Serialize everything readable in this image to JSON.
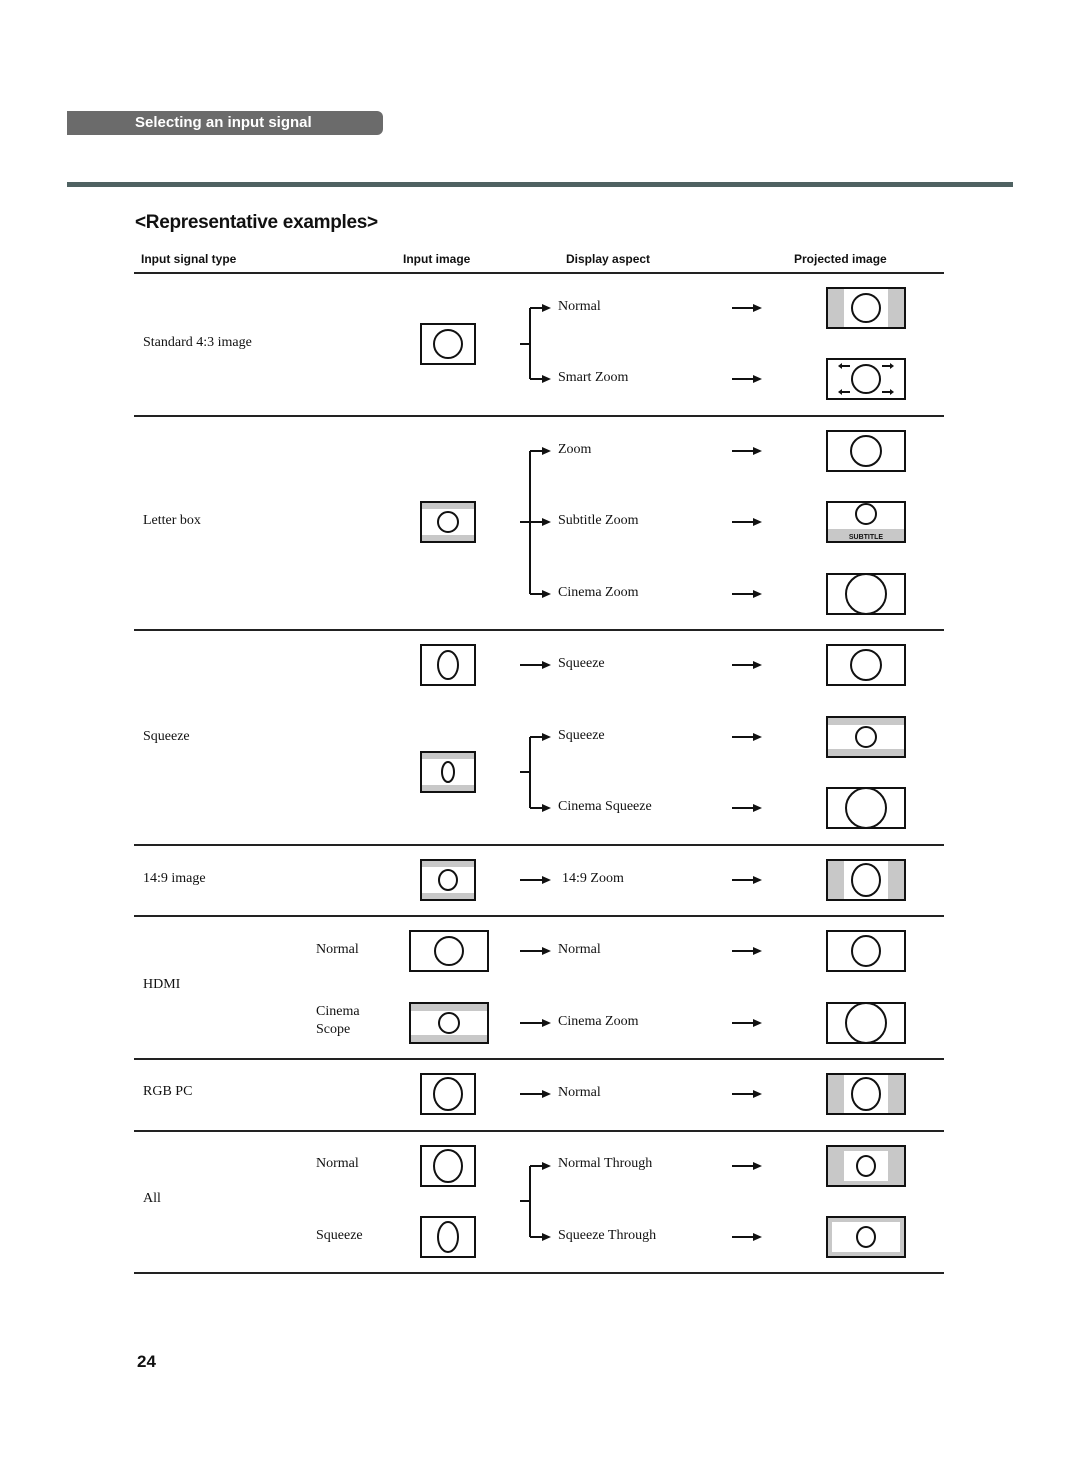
{
  "section_tab": "Selecting an input signal",
  "heading": "<Representative examples>",
  "columns": {
    "input_signal_type": "Input signal type",
    "input_image": "Input image",
    "display_aspect": "Display aspect",
    "projected_image": "Projected image"
  },
  "groups": [
    {
      "signal": "Standard 4:3 image",
      "rows": [
        {
          "sub": "",
          "input": "frame-4x3",
          "aspect": "Normal",
          "projected": "pillarbox"
        },
        {
          "sub": "",
          "input": "",
          "aspect": "Smart Zoom",
          "projected": "smart-zoom"
        }
      ]
    },
    {
      "signal": "Letter box",
      "rows": [
        {
          "sub": "",
          "input": "",
          "aspect": "Zoom",
          "projected": "full-circle"
        },
        {
          "sub": "",
          "input": "letterbox",
          "aspect": "Subtitle Zoom",
          "projected": "subtitle"
        },
        {
          "sub": "",
          "input": "",
          "aspect": "Cinema Zoom",
          "projected": "big-circle"
        }
      ],
      "subtitle_label": "SUBTITLE"
    },
    {
      "signal": "Squeeze",
      "rows": [
        {
          "sub": "",
          "input": "squeeze",
          "aspect": "Squeeze",
          "projected": "full-circle"
        },
        {
          "sub": "",
          "input": "letterbox-squeeze",
          "aspect": "Squeeze",
          "projected": "letterbox-wide"
        },
        {
          "sub": "",
          "input": "",
          "aspect": "Cinema Squeeze",
          "projected": "big-circle"
        }
      ]
    },
    {
      "signal": "14:9 image",
      "rows": [
        {
          "sub": "",
          "input": "letterbox-149",
          "aspect": "14:9 Zoom",
          "projected": "pillarbox-narrow"
        }
      ]
    },
    {
      "signal": "HDMI",
      "rows": [
        {
          "sub": "Normal",
          "input": "wide-normal",
          "aspect": "Normal",
          "projected": "tall-circle"
        },
        {
          "sub": "Cinema Scope",
          "input": "wide-scope",
          "aspect": "Cinema Zoom",
          "projected": "big-circle"
        }
      ]
    },
    {
      "signal": "RGB PC",
      "rows": [
        {
          "sub": "",
          "input": "frame-oval",
          "aspect": "Normal",
          "projected": "pillarbox-narrow"
        }
      ]
    },
    {
      "signal": "All",
      "rows": [
        {
          "sub": "Normal",
          "input": "frame-oval",
          "aspect": "Normal Through",
          "projected": "through-normal"
        },
        {
          "sub": "Squeeze",
          "input": "squeeze-tall",
          "aspect": "Squeeze Through",
          "projected": "through-squeeze"
        }
      ]
    }
  ],
  "colors": {
    "gray_fill": "#c8c8c8",
    "tab_bg": "#6b6b6b",
    "rule": "#4f6262"
  },
  "page_number": "24"
}
